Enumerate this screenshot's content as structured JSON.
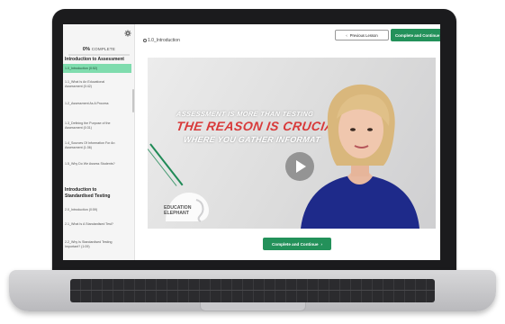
{
  "sidebar": {
    "progress_percent": "0%",
    "progress_label": "COMPLETE",
    "progress_value": 0,
    "section1_title": "Introduction to Assessment",
    "section1_lessons": [
      "1.0_Introduction (0:52)",
      "1.1_What Is An Educational\nAssessment (0:42)",
      "1.2_Assessment As A Process",
      "1.3_Defining the Purpose of the\nAssessment (0:31)",
      "1.4_Sources Of Information For An\nAssessment (1:36)",
      "1.5_Why Do We Assess Students?"
    ],
    "section2_title": "Introduction to\nStandardised Testing",
    "section2_lessons": [
      "2.0_Introduction (0:59)",
      "2.1_What Is A Standardised Test?",
      "2.2_Why Is Standardised Testing\nImportant? (1:09)"
    ]
  },
  "header": {
    "lesson_title": "1.0_Introduction",
    "prev_label": "Previous Lesson",
    "complete_label": "Complete and Continue"
  },
  "video": {
    "line1": "ASSESSMENT IS MORE THAN TESTING",
    "line2": "THE REASON IS CRUCIAL",
    "line3": "WHERE YOU GATHER INFORMAT",
    "logo_line1": "EDUCATION",
    "logo_line2": "ELEPHANT"
  },
  "footer": {
    "complete_label": "Complete and Continue"
  },
  "colors": {
    "accent": "#23915a",
    "active_lesson": "#7fdcae",
    "headline_red": "#d83a3a"
  }
}
